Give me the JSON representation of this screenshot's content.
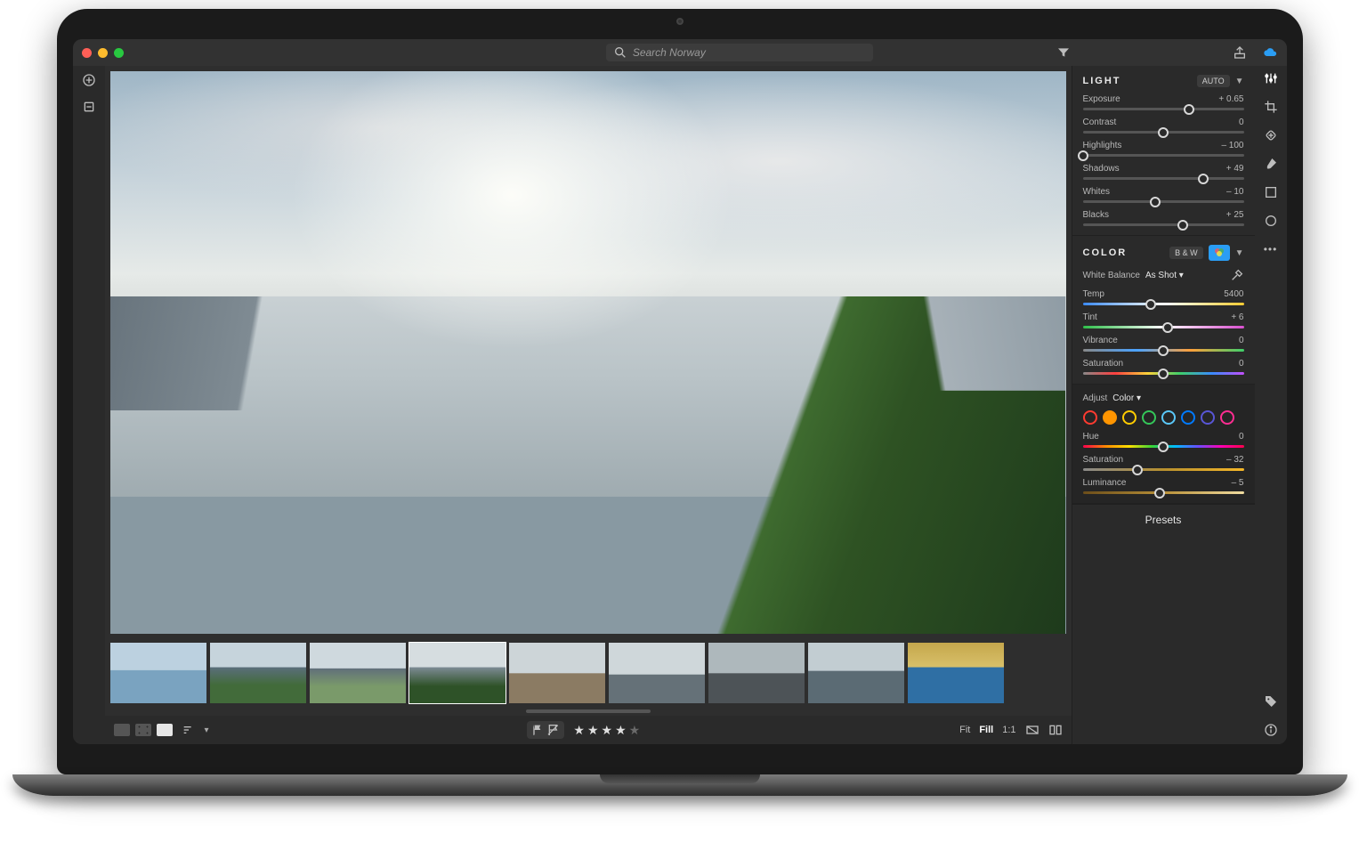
{
  "search": {
    "placeholder": "Search Norway"
  },
  "panels": {
    "light": {
      "title": "LIGHT",
      "auto": "AUTO",
      "sliders": {
        "exposure": {
          "label": "Exposure",
          "value": "+ 0.65",
          "pos": 66
        },
        "contrast": {
          "label": "Contrast",
          "value": "0",
          "pos": 50
        },
        "highlights": {
          "label": "Highlights",
          "value": "– 100",
          "pos": 0
        },
        "shadows": {
          "label": "Shadows",
          "value": "+ 49",
          "pos": 75
        },
        "whites": {
          "label": "Whites",
          "value": "– 10",
          "pos": 45
        },
        "blacks": {
          "label": "Blacks",
          "value": "+ 25",
          "pos": 62
        }
      }
    },
    "color": {
      "title": "COLOR",
      "bw": "B & W",
      "wb_label": "White Balance",
      "wb_value": "As Shot",
      "sliders": {
        "temp": {
          "label": "Temp",
          "value": "5400",
          "pos": 42
        },
        "tint": {
          "label": "Tint",
          "value": "+ 6",
          "pos": 53
        },
        "vibrance": {
          "label": "Vibrance",
          "value": "0",
          "pos": 50
        },
        "saturation": {
          "label": "Saturation",
          "value": "0",
          "pos": 50
        }
      }
    },
    "adjust": {
      "prefix": "Adjust",
      "mode": "Color",
      "swatches": [
        "#ff3b30",
        "#ff9500",
        "#ffcc00",
        "#34c759",
        "#5ac8fa",
        "#007aff",
        "#5856d6",
        "#ff2d92"
      ],
      "selected_index": 1,
      "sliders": {
        "hue": {
          "label": "Hue",
          "value": "0",
          "pos": 50
        },
        "saturation": {
          "label": "Saturation",
          "value": "– 32",
          "pos": 34
        },
        "luminance": {
          "label": "Luminance",
          "value": "– 5",
          "pos": 48
        }
      }
    },
    "presets": {
      "title": "Presets"
    }
  },
  "bottom": {
    "zoom": {
      "fit": "Fit",
      "fill": "Fill",
      "one": "1:1"
    },
    "stars": 4
  },
  "filmstrip": {
    "selected_index": 3,
    "count": 9
  }
}
